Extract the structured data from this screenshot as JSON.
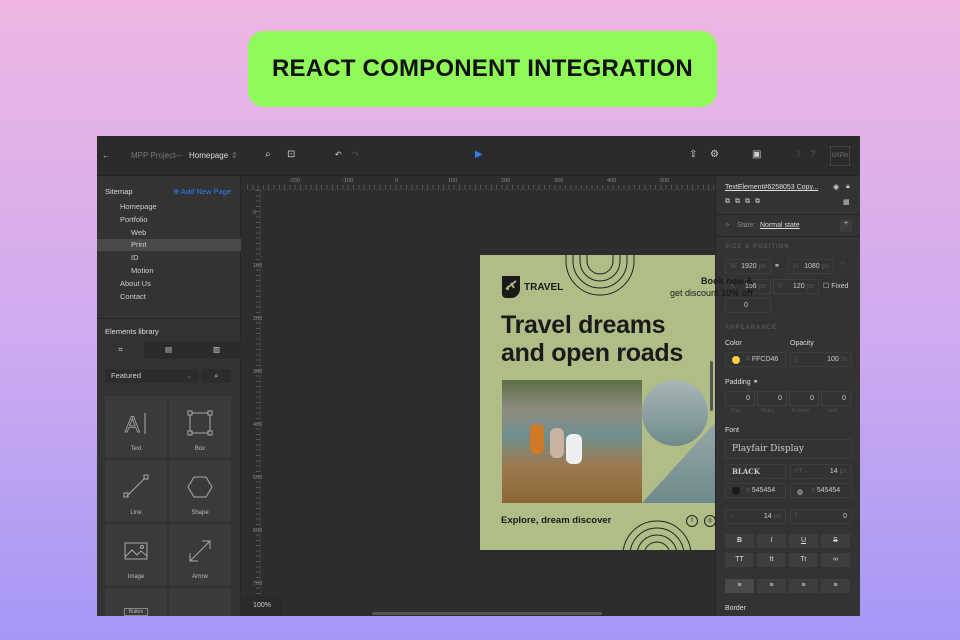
{
  "banner": {
    "title": "REACT COMPONENT INTEGRATION"
  },
  "topbar": {
    "project": "MPP Project",
    "separator": "—",
    "page": "Homepage",
    "logo": "UXPin"
  },
  "sitemap": {
    "title": "Sitemap",
    "add_label": "Add New Page",
    "items": [
      {
        "label": "Homepage"
      },
      {
        "label": "Portfolio"
      },
      {
        "label": "Web"
      },
      {
        "label": "Print"
      },
      {
        "label": "ID"
      },
      {
        "label": "Motion"
      },
      {
        "label": "About Us"
      },
      {
        "label": "Contact"
      }
    ]
  },
  "library": {
    "title": "Elements library",
    "filter": "Featured",
    "items": [
      {
        "label": "Text"
      },
      {
        "label": "Box"
      },
      {
        "label": "Line"
      },
      {
        "label": "Shape"
      },
      {
        "label": "Image"
      },
      {
        "label": "Arrow"
      }
    ],
    "partial": "Button"
  },
  "canvas": {
    "zoom": "100%",
    "ruler_top": [
      "-200",
      "-100",
      "0",
      "100",
      "200",
      "300",
      "400",
      "500"
    ],
    "ruler_left": [
      "0",
      "100",
      "200",
      "300",
      "400",
      "500",
      "600",
      "700"
    ]
  },
  "design": {
    "brand": "TRAVEL",
    "promo_line1": "Book now &",
    "promo_line2_pre": "get discount ",
    "promo_line2_bold": "10% off",
    "headline1": "Travel dreams",
    "headline2": "and open roads",
    "footer": "Explore, dream discover"
  },
  "props": {
    "element": "TextElement#6258053 Copy...",
    "state_label": "State:",
    "state": "Normal state",
    "size_title": "SIZE & POSITION",
    "w": "1920",
    "h": "1080",
    "x": "156",
    "y": "120",
    "unit": "px",
    "fixed": "Fixed",
    "rotation": "0",
    "appearance_title": "APPEARANCE",
    "color_label": "Color",
    "color": "FFCD46",
    "opacity_label": "Opacity",
    "opacity": "100",
    "percent": "%",
    "padding_label": "Padding",
    "padding": [
      {
        "v": "0",
        "l": "Top"
      },
      {
        "v": "0",
        "l": "Right"
      },
      {
        "v": "0",
        "l": "Bottom"
      },
      {
        "v": "0",
        "l": "Left"
      }
    ],
    "font_label": "Font",
    "font": "Playfair Display",
    "weight": "BLACK",
    "size": "14",
    "text_color": "545454",
    "bg_color": "545454",
    "line_height": "14",
    "letter_spacing": "0",
    "styles": [
      "B",
      "I",
      "U",
      "S",
      "TT",
      "tt",
      "Tr",
      "∞"
    ],
    "border_label": "Border"
  },
  "colors": {
    "accent": "#2f7cf6",
    "swatch": "#FFCD46",
    "card": "#b1bd87",
    "banner": "#8ff95a"
  }
}
